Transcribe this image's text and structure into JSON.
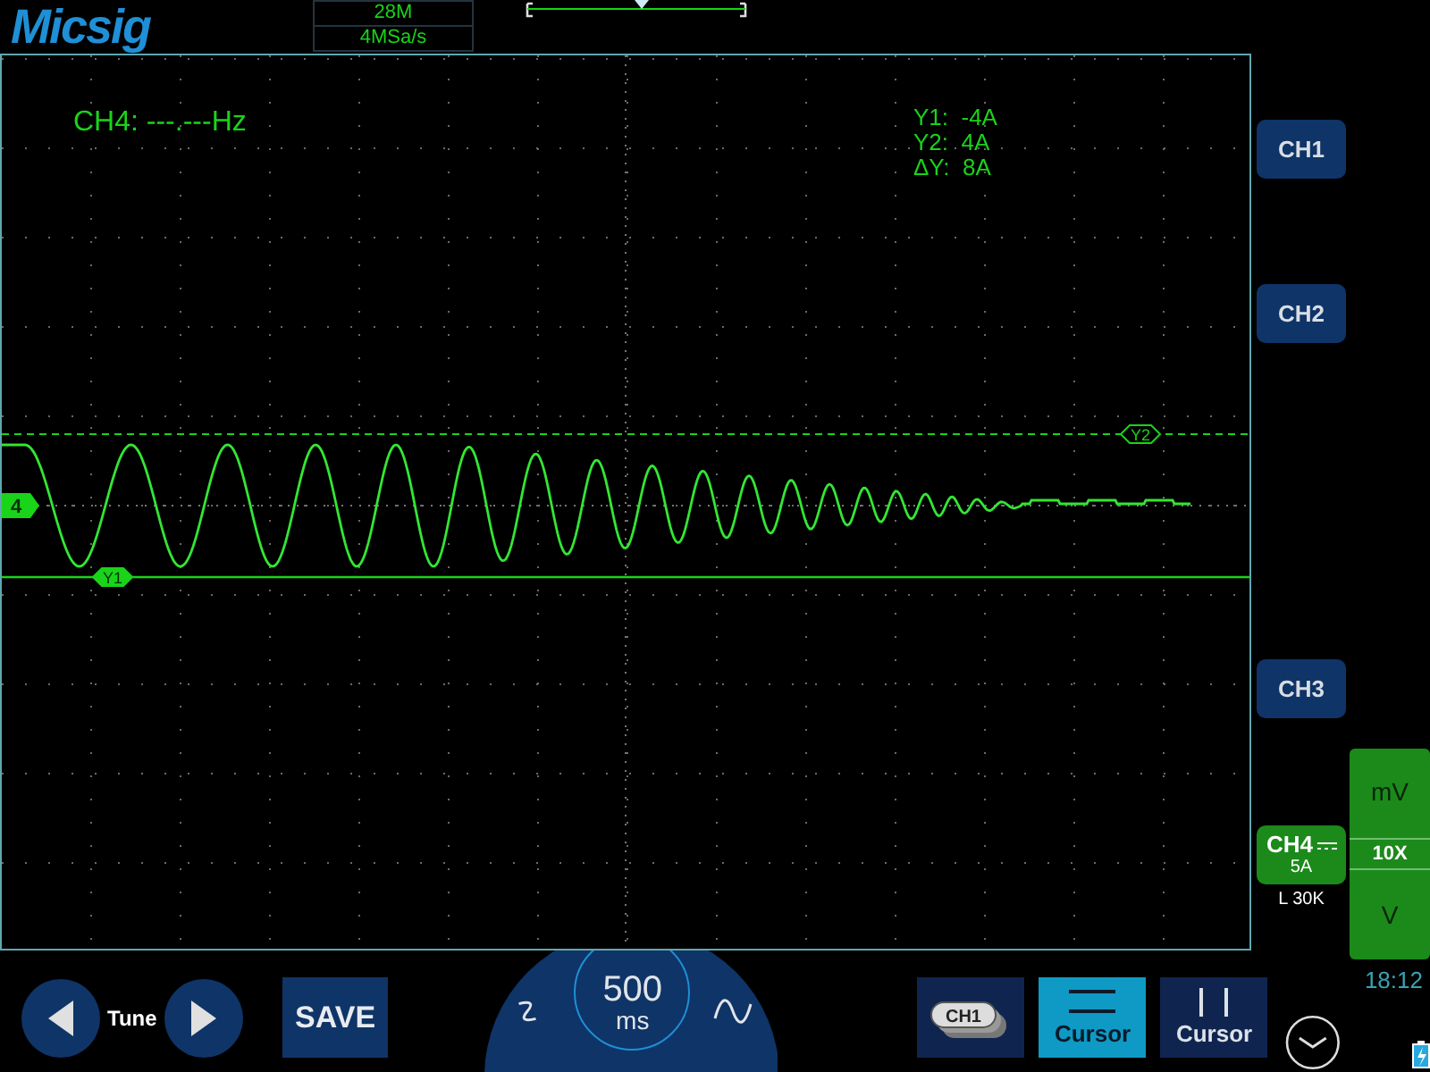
{
  "brand": "Micsig",
  "acquisition": {
    "memory_depth": "28M",
    "sample_rate": "4MSa/s"
  },
  "screen": {
    "frequency_readout": "CH4: ---.---Hz",
    "cursor_readouts": [
      "Y1:  -4A",
      "Y2:  4A",
      "ΔY:  8A"
    ],
    "cursor_tags": [
      {
        "label": "Y2",
        "kind": "dashed"
      },
      {
        "label": "Y1",
        "kind": "solid"
      }
    ],
    "channel_marker": "4"
  },
  "channel_buttons": [
    {
      "label": "CH1",
      "selected": false
    },
    {
      "label": "CH2",
      "selected": false
    },
    {
      "label": "CH3",
      "selected": false
    },
    {
      "label": "CH4",
      "selected": true,
      "scale": "5A",
      "coupling": "L 30K"
    }
  ],
  "unit_panel": {
    "upper": "mV",
    "probe": "10X",
    "lower": "V"
  },
  "clock": "18:12",
  "tune": {
    "label": "Tune"
  },
  "save": "SAVE",
  "timebase": {
    "value": "500",
    "unit": "ms"
  },
  "tool_buttons": [
    {
      "kind": "channel",
      "label": "CH1",
      "selected": false
    },
    {
      "kind": "horizontal_cursor",
      "label": "Cursor",
      "selected": true
    },
    {
      "kind": "vertical_cursor",
      "label": "Cursor",
      "selected": false
    }
  ]
}
